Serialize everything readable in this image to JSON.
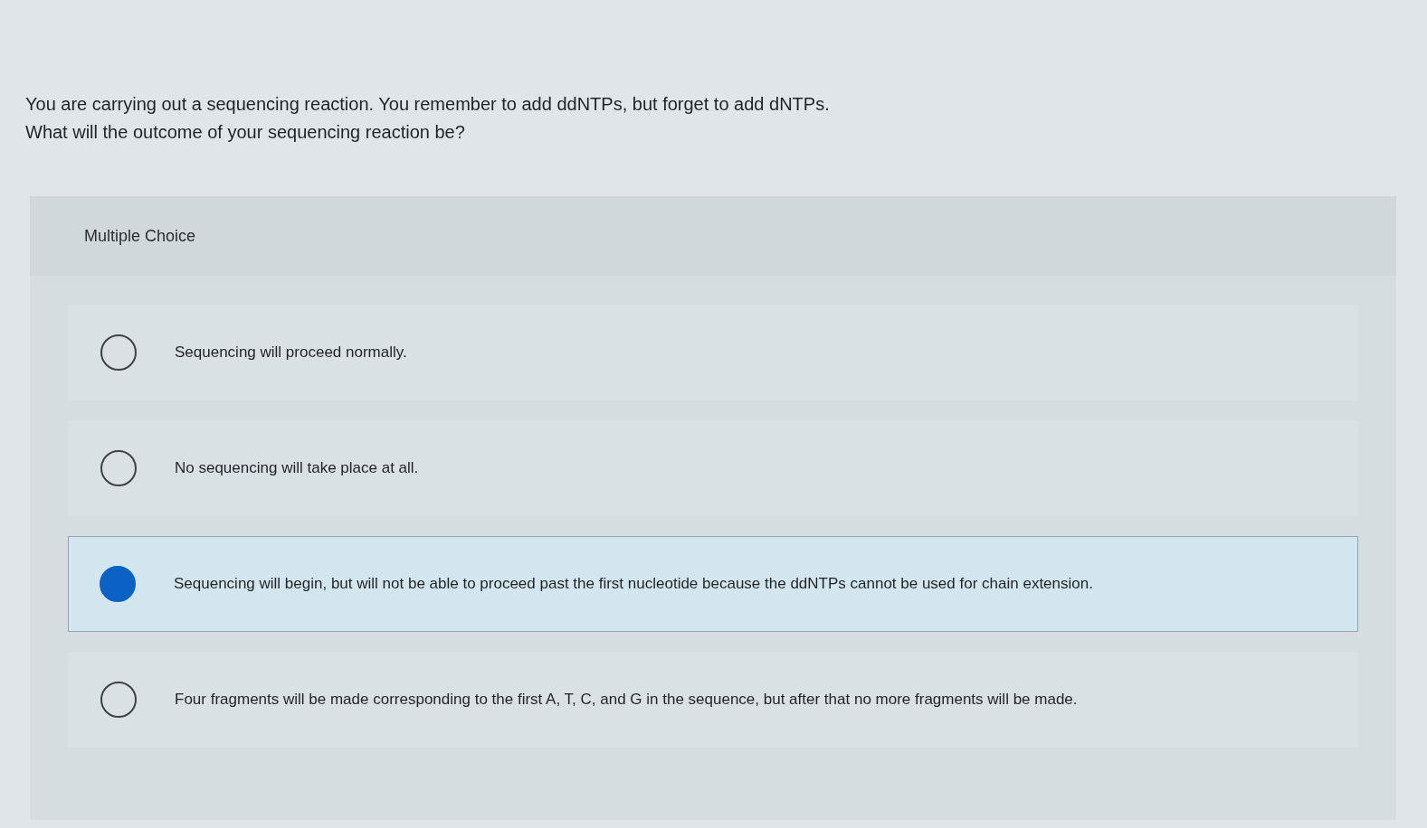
{
  "question": {
    "lines": [
      "You are carrying out a sequencing reaction. You remember to add ddNTPs, but forget to add dNTPs.",
      "What will the outcome of your sequencing reaction be?"
    ]
  },
  "panel": {
    "heading": "Multiple Choice",
    "options": [
      {
        "text": "Sequencing will proceed normally.",
        "selected": false
      },
      {
        "text": "No sequencing will take place at all.",
        "selected": false
      },
      {
        "text": "Sequencing will begin, but will not be able to proceed past the first nucleotide because the ddNTPs cannot be used for chain extension.",
        "selected": true
      },
      {
        "text": "Four fragments will be made corresponding to the first A, T, C, and G in the sequence, but after that no more fragments will be made.",
        "selected": false
      }
    ]
  }
}
